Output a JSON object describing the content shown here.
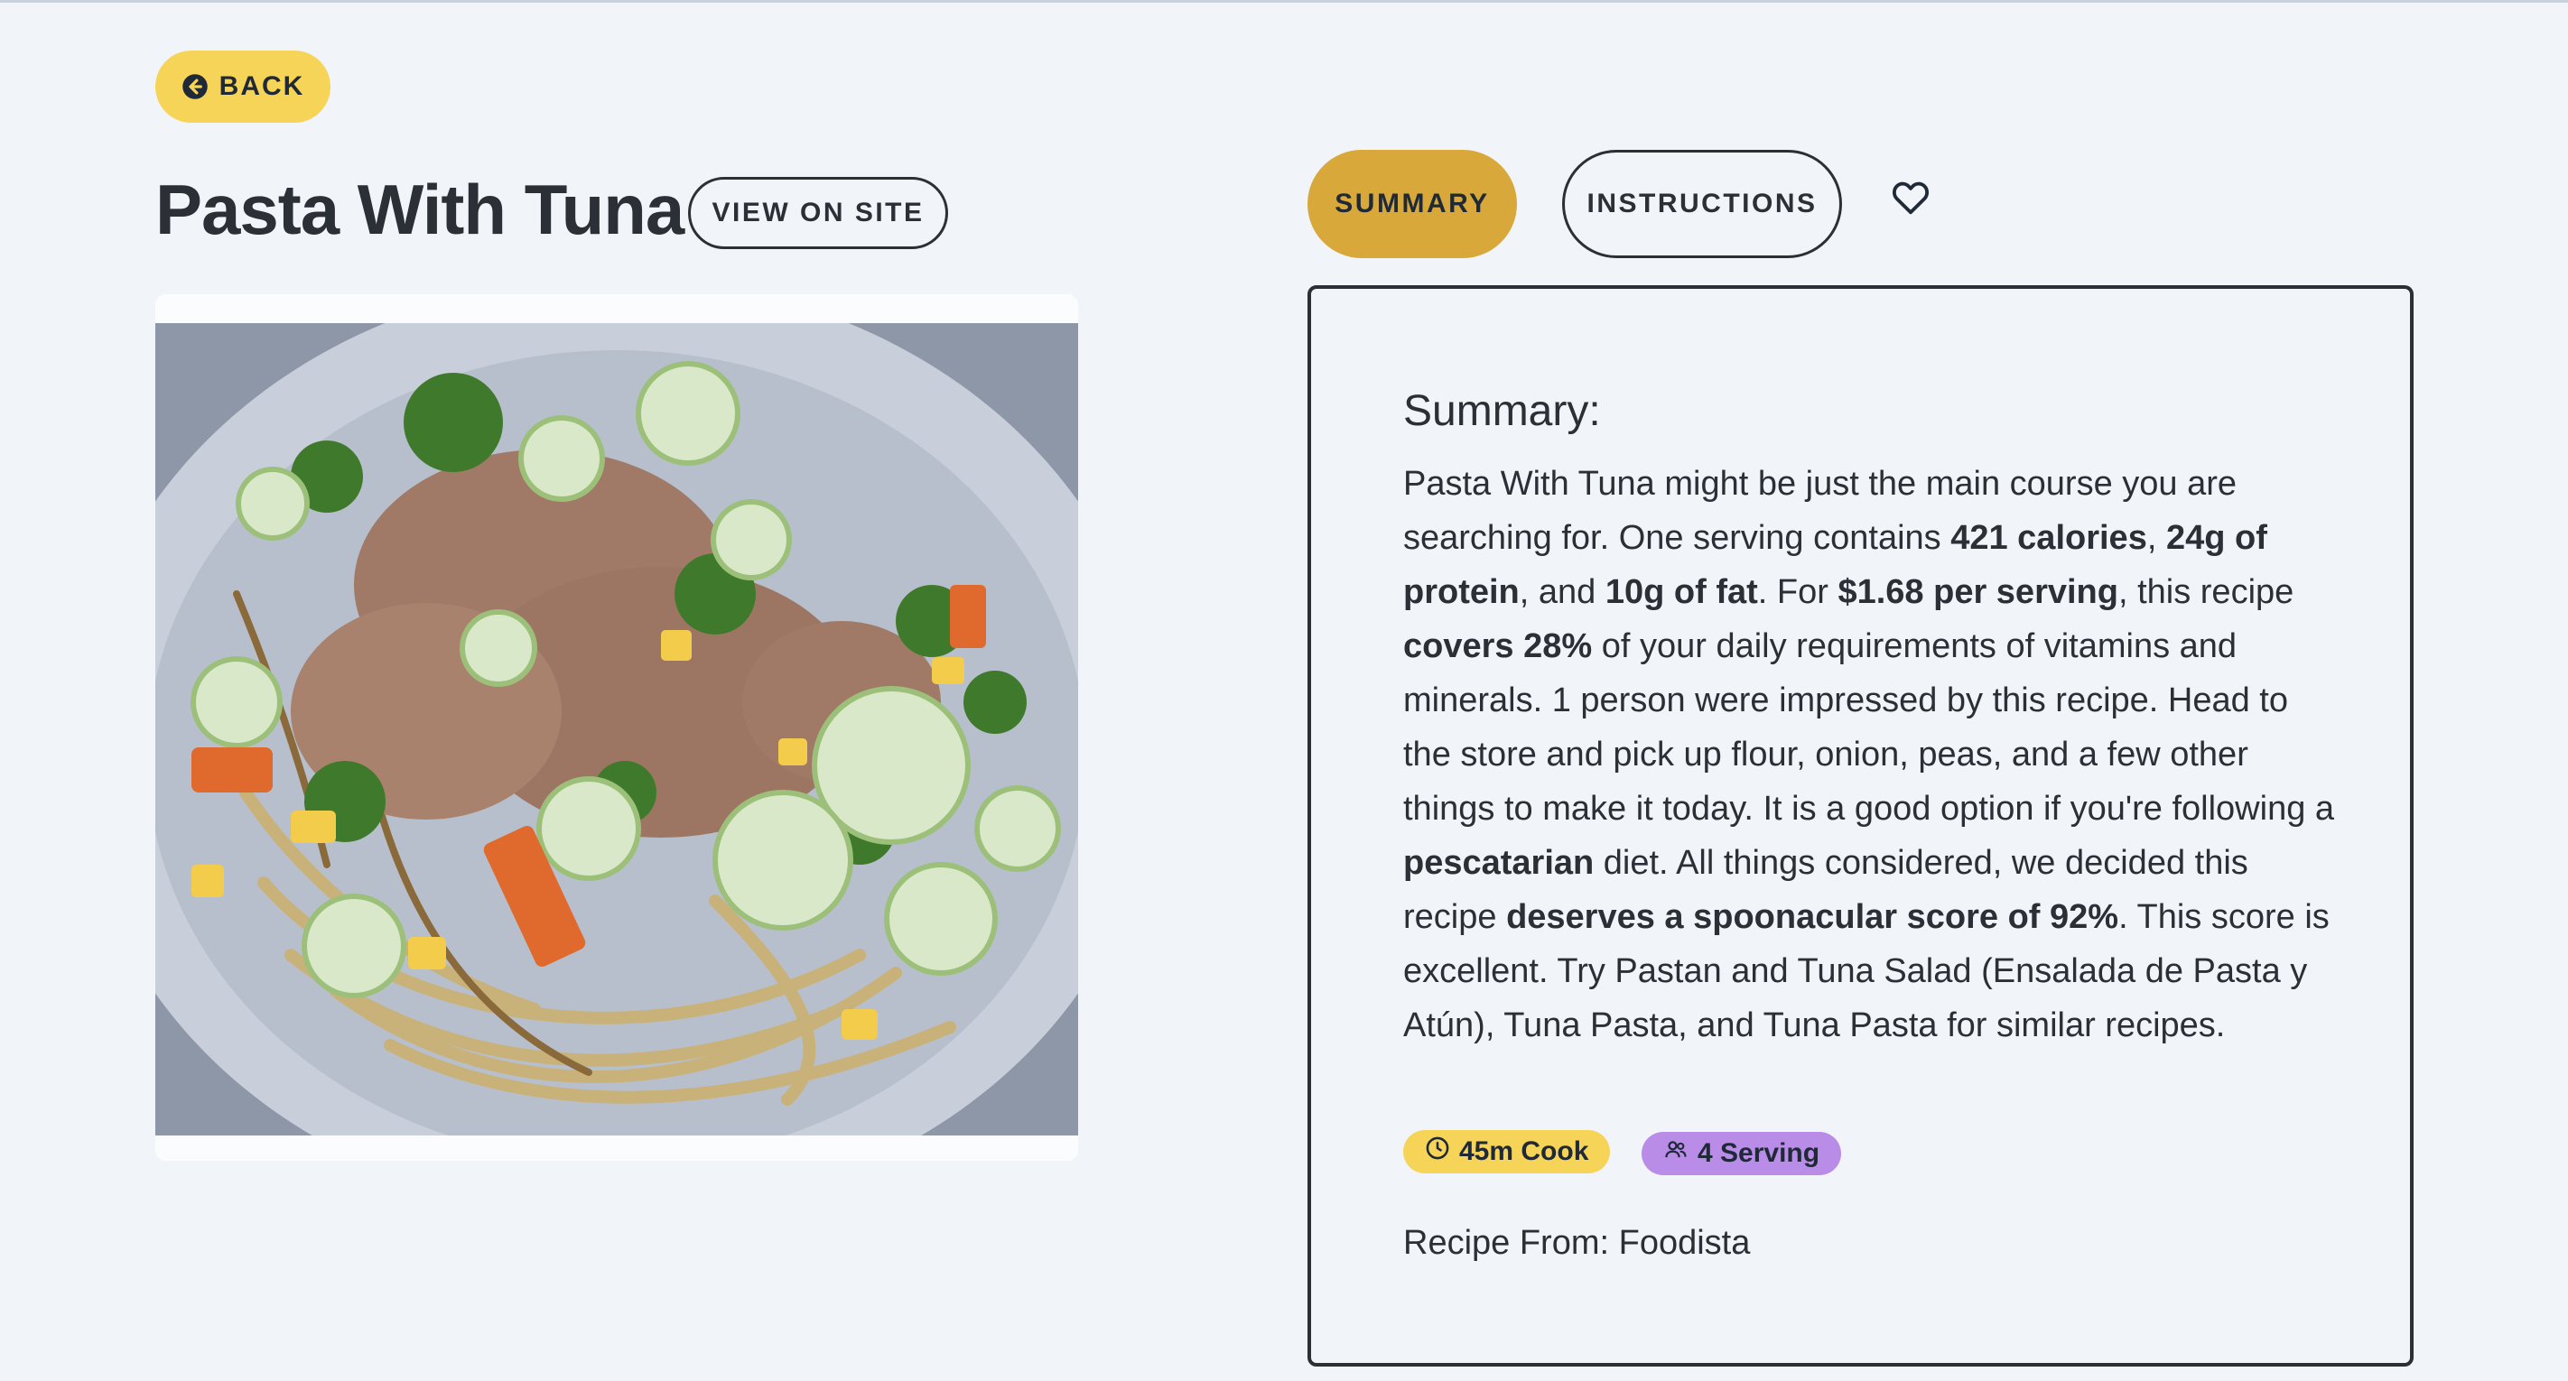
{
  "nav": {
    "back_label": "BACK",
    "back_icon": "arrow-left-circle-icon"
  },
  "recipe": {
    "title": "Pasta With Tuna",
    "view_on_site_label": "VIEW ON SITE",
    "image_alt": "Pasta With Tuna"
  },
  "tabs": [
    {
      "label": "SUMMARY",
      "active": true
    },
    {
      "label": "INSTRUCTIONS",
      "active": false
    }
  ],
  "favorite_icon": "heart-icon",
  "summary": {
    "heading": "Summary:",
    "segments": [
      {
        "text": "Pasta With Tuna might be just the main course you are searching for. One serving contains ",
        "bold": false
      },
      {
        "text": "421 calories",
        "bold": true
      },
      {
        "text": ", ",
        "bold": false
      },
      {
        "text": "24g of protein",
        "bold": true
      },
      {
        "text": ", and ",
        "bold": false
      },
      {
        "text": "10g of fat",
        "bold": true
      },
      {
        "text": ". For ",
        "bold": false
      },
      {
        "text": "$1.68 per serving",
        "bold": true
      },
      {
        "text": ", this recipe ",
        "bold": false
      },
      {
        "text": "covers 28%",
        "bold": true
      },
      {
        "text": " of your daily requirements of vitamins and minerals. 1 person were impressed by this recipe. Head to the store and pick up flour, onion, peas, and a few other things to make it today. It is a good option if you're following a ",
        "bold": false
      },
      {
        "text": "pescatarian",
        "bold": true
      },
      {
        "text": " diet. All things considered, we decided this recipe ",
        "bold": false
      },
      {
        "text": "deserves a spoonacular score of 92%",
        "bold": true
      },
      {
        "text": ". This score is excellent. Try Pastan and Tuna Salad (Ensalada de Pasta y Atún), Tuna Pasta, and Tuna Pasta for similar recipes.",
        "bold": false
      }
    ],
    "cook_time_label": "45m Cook",
    "servings_label": "4 Serving",
    "source_text": "Recipe From: Foodista"
  },
  "colors": {
    "background": "#f1f4f9",
    "back_button": "#f6d458",
    "active_tab": "#d8a93a",
    "cook_badge": "#f6d458",
    "serving_badge": "#b98ce8",
    "text": "#2b2f36"
  }
}
